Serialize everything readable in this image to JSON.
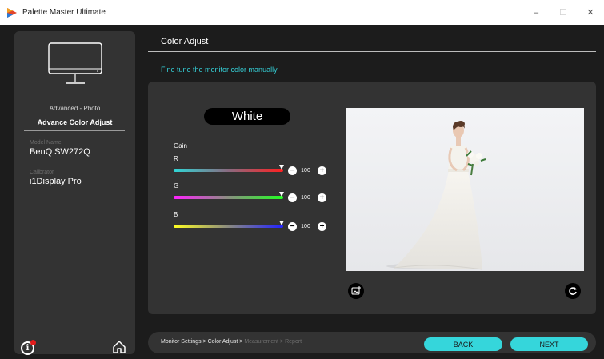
{
  "window": {
    "title": "Palette Master Ultimate",
    "controls": {
      "minimize": "–",
      "maximize": "☐",
      "close": "✕"
    }
  },
  "sidebar": {
    "mode": "Advanced - Photo",
    "mode_name": "Advance Color Adjust",
    "model_label": "Model Name",
    "model_value": "BenQ SW272Q",
    "calibrator_label": "Calibrator",
    "calibrator_value": "i1Display Pro",
    "info_icon": "info-icon",
    "home_icon": "home-icon"
  },
  "header": {
    "title": "Color Adjust",
    "subtitle": "Fine tune the monitor color manually"
  },
  "panel": {
    "target": "White",
    "gain_label": "Gain",
    "channels": [
      {
        "name": "R",
        "value": "100"
      },
      {
        "name": "G",
        "value": "100"
      },
      {
        "name": "B",
        "value": "100"
      }
    ],
    "minus": "−",
    "plus": "+"
  },
  "footer": {
    "crumbs": [
      {
        "label": "Monitor Settings >",
        "done": true
      },
      {
        "label": "Color Adjust >",
        "done": true
      },
      {
        "label": "Measurement >",
        "done": false
      },
      {
        "label": "Report",
        "done": false
      }
    ],
    "back_label": "BACK",
    "next_label": "NEXT"
  },
  "colors": {
    "accent": "#35d6db",
    "panel": "#333333",
    "background": "#1c1c1c"
  }
}
